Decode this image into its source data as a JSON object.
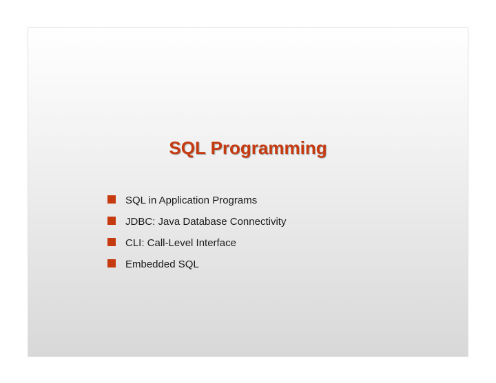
{
  "slide": {
    "title": "SQL Programming",
    "bullets": [
      "SQL in Application Programs",
      "JDBC: Java Database Connectivity",
      "CLI: Call-Level Interface",
      "Embedded SQL"
    ]
  }
}
